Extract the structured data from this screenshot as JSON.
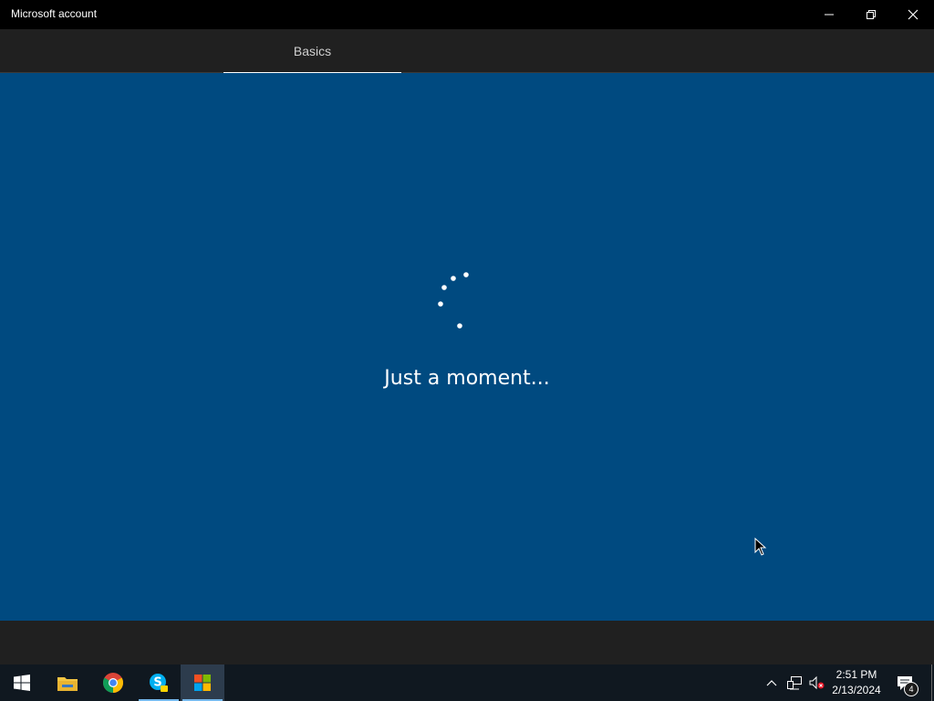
{
  "window": {
    "title": "Microsoft account",
    "controls": [
      "minimize",
      "restore",
      "close"
    ]
  },
  "tabs": [
    {
      "label": "Basics",
      "selected": true
    }
  ],
  "main": {
    "status_text": "Just a moment...",
    "background": "#004a80",
    "loading": true
  },
  "taskbar": {
    "pinned": [
      {
        "name": "start",
        "icon": "windows-logo-icon"
      },
      {
        "name": "file-explorer",
        "icon": "folder-icon"
      },
      {
        "name": "chrome",
        "icon": "chrome-icon"
      },
      {
        "name": "skype",
        "icon": "skype-icon",
        "running": true
      },
      {
        "name": "microsoft-store",
        "icon": "microsoft-logo-icon",
        "active": true
      }
    ],
    "tray": {
      "time": "2:51 PM",
      "date": "2/13/2024",
      "notifications_count": "4"
    }
  },
  "colors": {
    "accent": "#76b9ed",
    "titlebar": "#000000",
    "tabbar": "#202020",
    "taskbar": "#101820"
  }
}
